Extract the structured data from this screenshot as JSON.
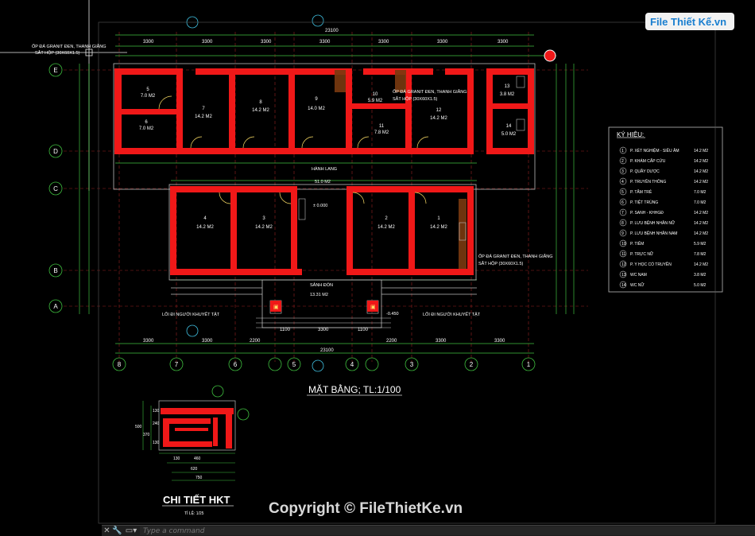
{
  "logo": {
    "brand": "File Thiết Kế.vn"
  },
  "watermark": "Copyright © FileThietKe.vn",
  "command_bar": {
    "placeholder": "Type a command",
    "close_glyph": "✕",
    "settings_glyph": "🔧",
    "prompt_glyph": "▭▾"
  },
  "plan": {
    "title": "MẶT BẰNG; TL:1/100",
    "overall_dim": "23100",
    "grid_rows": [
      "E",
      "D",
      "C",
      "B",
      "A"
    ],
    "grid_cols": [
      "8",
      "7",
      "6",
      "5",
      "4",
      "3",
      "2",
      "1"
    ],
    "top_dims": [
      "3300",
      "3300",
      "3300",
      "3300",
      "3300",
      "3300",
      "3300"
    ],
    "bottom_dims": [
      "3300",
      "3300",
      "2200",
      "1100",
      "3300",
      "1100",
      "2200",
      "3300",
      "3300"
    ],
    "notes": {
      "granite_tl": "ỐP ĐÁ GRANIT ĐEN, THANH GIẰNG",
      "granite_tl2": "SẮT HỘP (30X60X1.5)",
      "granite_mid": "ỐP ĐÁ GRANIT ĐEN, THANH GIẰNG",
      "granite_mid2": "SẮT HỘP (30X60X1.5)",
      "granite_br": "ỐP ĐÁ GRANIT ĐEN, THANH GIẰNG",
      "granite_br2": "SẮT HỘP (30X60X1.5)",
      "corridor": "HÀNH LANG",
      "corridor_area": "51.0 M2",
      "lobby": "SẢNH ĐÓN",
      "lobby_area": "13.31 M2",
      "ramp_left": "LỐI ĐI NGƯỜI KHUYẾT TẬT",
      "ramp_right": "LỐI ĐI NGƯỜI KHUYẾT TẬT",
      "level": "± 0.000",
      "level2": "-0.450"
    },
    "rooms_top": [
      {
        "num": "5",
        "area": "7.0 M2"
      },
      {
        "num": "6",
        "area": "7.0 M2"
      },
      {
        "num": "7",
        "area": "14.2 M2"
      },
      {
        "num": "8",
        "area": "14.2 M2"
      },
      {
        "num": "9",
        "area": "14.0 M2"
      },
      {
        "num": "10",
        "area": "5.9 M2"
      },
      {
        "num": "11",
        "area": "7.8 M2"
      },
      {
        "num": "12",
        "area": "14.2 M2"
      },
      {
        "num": "13",
        "area": "3.8 M2"
      },
      {
        "num": "14",
        "area": "5.0 M2"
      }
    ],
    "rooms_bottom": [
      {
        "num": "4",
        "area": "14.2 M2"
      },
      {
        "num": "3",
        "area": "14.2 M2"
      },
      {
        "num": "2",
        "area": "14.2 M2"
      },
      {
        "num": "1",
        "area": "14.2 M2"
      }
    ]
  },
  "legend": {
    "title": "KÝ HIỆU:",
    "items": [
      {
        "n": "1",
        "name": "P. XÉT NGHIỆM - SIÊU ÂM",
        "area": "14.2 M2"
      },
      {
        "n": "2",
        "name": "P. KHÁM CẤP CỨU",
        "area": "14.2 M2"
      },
      {
        "n": "3",
        "name": "P. QUẦY DƯỢC",
        "area": "14.2 M2"
      },
      {
        "n": "4",
        "name": "P. TRUYỀN THÔNG",
        "area": "14.2 M2"
      },
      {
        "n": "5",
        "name": "P. TẮM TRẺ",
        "area": "7.0 M2"
      },
      {
        "n": "6",
        "name": "P. TIỆT TRÙNG",
        "area": "7.0 M2"
      },
      {
        "n": "7",
        "name": "P. SANH - KHHGĐ",
        "area": "14.2 M2"
      },
      {
        "n": "8",
        "name": "P. LƯU BỆNH NHÂN NỮ",
        "area": "14.2 M2"
      },
      {
        "n": "9",
        "name": "P. LƯU BỆNH NHÂN NAM",
        "area": "14.2 M2"
      },
      {
        "n": "10",
        "name": "P. TIÊM",
        "area": "5.9 M2"
      },
      {
        "n": "11",
        "name": "P. TRỰC NỮ",
        "area": "7.8 M2"
      },
      {
        "n": "12",
        "name": "P. Y HỌC CỔ TRUYỀN",
        "area": "14.2 M2"
      },
      {
        "n": "13",
        "name": "WC NAM",
        "area": "3.8 M2"
      },
      {
        "n": "14",
        "name": "WC NỮ",
        "area": "5.0 M2"
      }
    ]
  },
  "detail": {
    "title": "CHI TIẾT HKT",
    "scale": "TỈ LỆ: 1/25",
    "dims_bottom": [
      "130",
      "460",
      "620",
      "750"
    ],
    "dims_left": [
      "500",
      "370",
      "130",
      "240",
      "130"
    ]
  }
}
